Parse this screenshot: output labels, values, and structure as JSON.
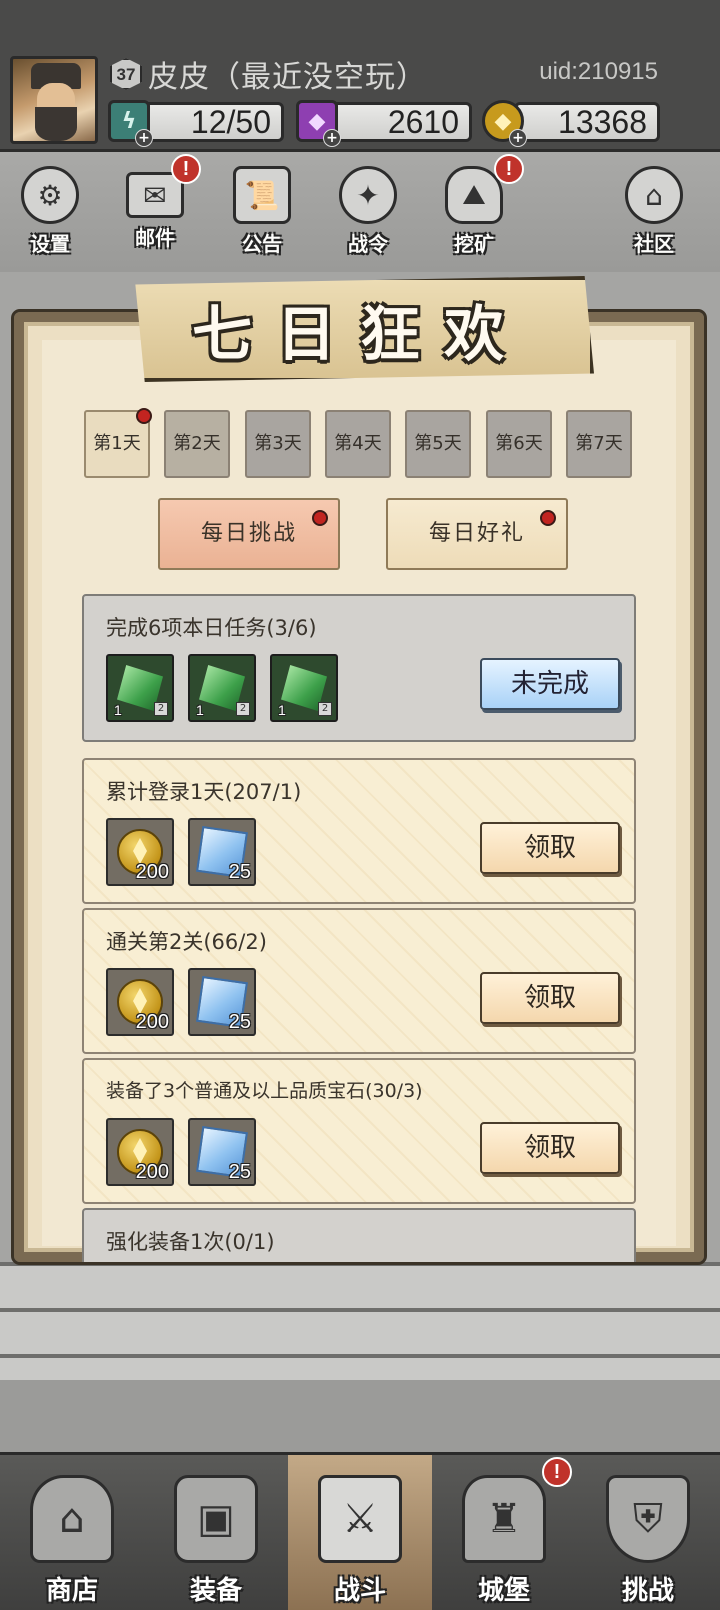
{
  "player": {
    "level": "37",
    "name": "皮皮（最近没空玩）",
    "uid": "uid:210915"
  },
  "resources": {
    "energy": "12/50",
    "gems": "2610",
    "coins": "13368"
  },
  "toolbar": [
    {
      "label": "设置",
      "icon": "gear-icon"
    },
    {
      "label": "邮件",
      "icon": "mail-icon",
      "alert": "!"
    },
    {
      "label": "公告",
      "icon": "scroll-icon"
    },
    {
      "label": "战令",
      "icon": "crystal-ball-icon"
    },
    {
      "label": "挖矿",
      "icon": "ore-icon",
      "alert": "!"
    },
    {
      "label": "社区",
      "icon": "home-icon"
    }
  ],
  "event": {
    "title": "七日狂欢",
    "days": [
      "第1天",
      "第2天",
      "第3天",
      "第4天",
      "第5天",
      "第6天",
      "第7天"
    ],
    "sub_tabs": [
      "每日挑战",
      "每日好礼"
    ],
    "tasks": [
      {
        "title": "完成6项本日任务(3/6)",
        "button": "未完成",
        "rewards": [
          "1",
          "1",
          "1"
        ]
      },
      {
        "title": "累计登录1天(207/1)",
        "button": "领取",
        "rewards": [
          "200",
          "25"
        ]
      },
      {
        "title": "通关第2关(66/2)",
        "button": "领取",
        "rewards": [
          "200",
          "25"
        ]
      },
      {
        "title": "装备了3个普通及以上品质宝石(30/3)",
        "button": "领取",
        "rewards": [
          "200",
          "25"
        ]
      },
      {
        "title": "强化装备1次(0/1)"
      }
    ]
  },
  "bottom_nav": [
    {
      "label": "商店",
      "icon": "shop-icon"
    },
    {
      "label": "装备",
      "icon": "backpack-icon"
    },
    {
      "label": "战斗",
      "icon": "crossed-swords-icon",
      "active": true
    },
    {
      "label": "城堡",
      "icon": "castle-icon",
      "alert": "!"
    },
    {
      "label": "挑战",
      "icon": "shield-icon"
    }
  ],
  "colors": {
    "alert_red": "#c0332b",
    "parchment": "#f2e8d2",
    "button_blue": "#a9d2f7"
  }
}
